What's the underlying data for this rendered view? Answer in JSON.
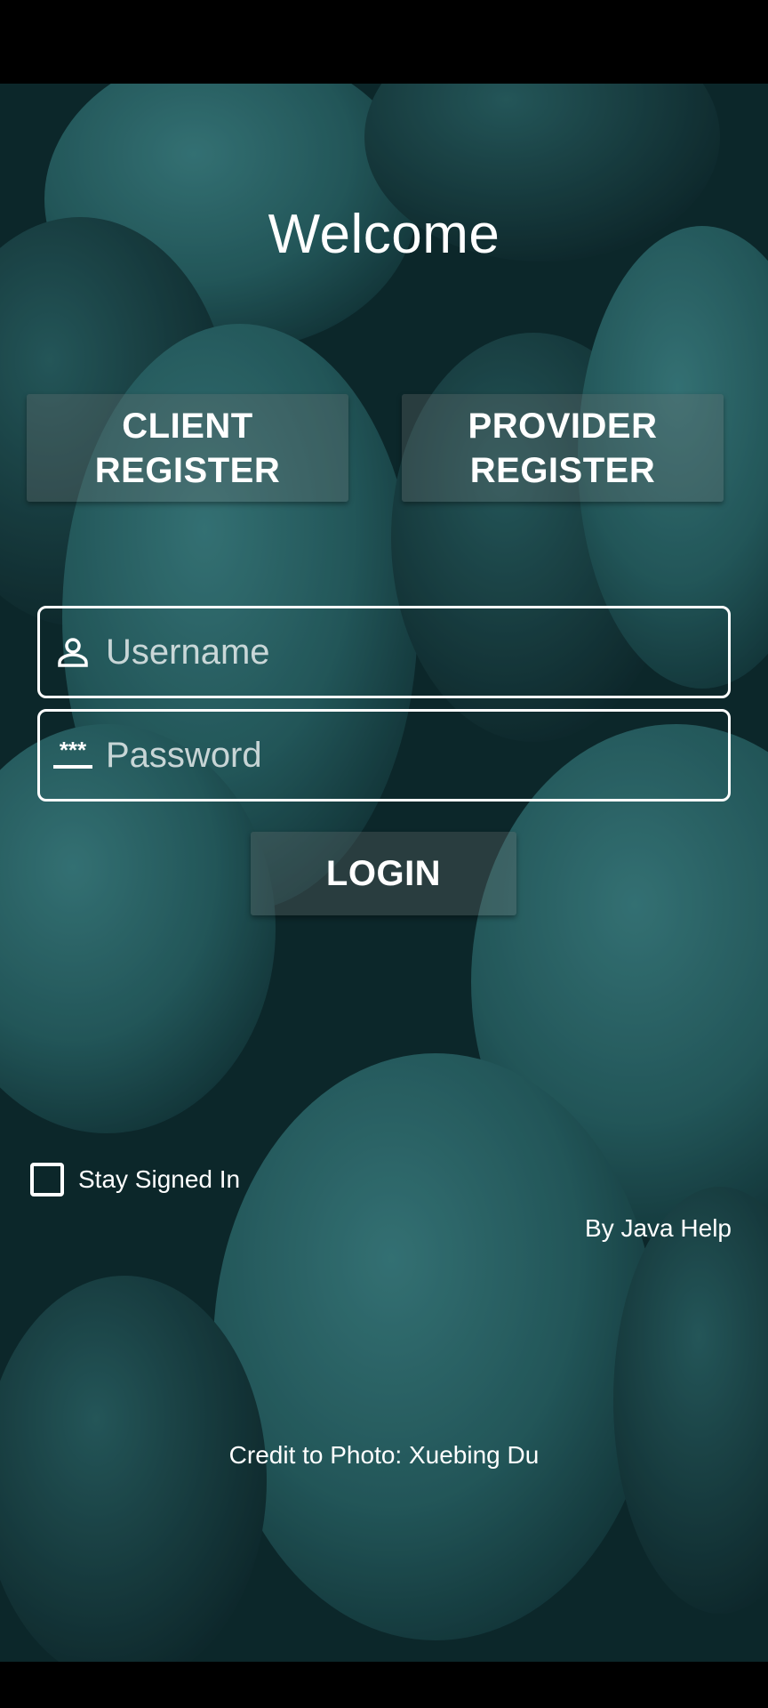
{
  "header": {
    "title": "Welcome"
  },
  "buttons": {
    "client_register": "CLIENT\nREGISTER",
    "provider_register": "PROVIDER\nREGISTER",
    "login": "LOGIN"
  },
  "form": {
    "username": {
      "value": "",
      "placeholder": "Username",
      "icon": "person-icon"
    },
    "password": {
      "value": "",
      "placeholder": "Password",
      "icon": "password-icon"
    }
  },
  "stay_signed_in": {
    "label": "Stay Signed In",
    "checked": false
  },
  "footer": {
    "by_line": "By Java Help",
    "credit": "Credit to Photo: Xuebing Du"
  },
  "colors": {
    "background": "#1e4a4d",
    "leaf": "#2f6e70",
    "leaf_dark": "#133134",
    "button": "#6b7778",
    "text": "#ffffff"
  }
}
